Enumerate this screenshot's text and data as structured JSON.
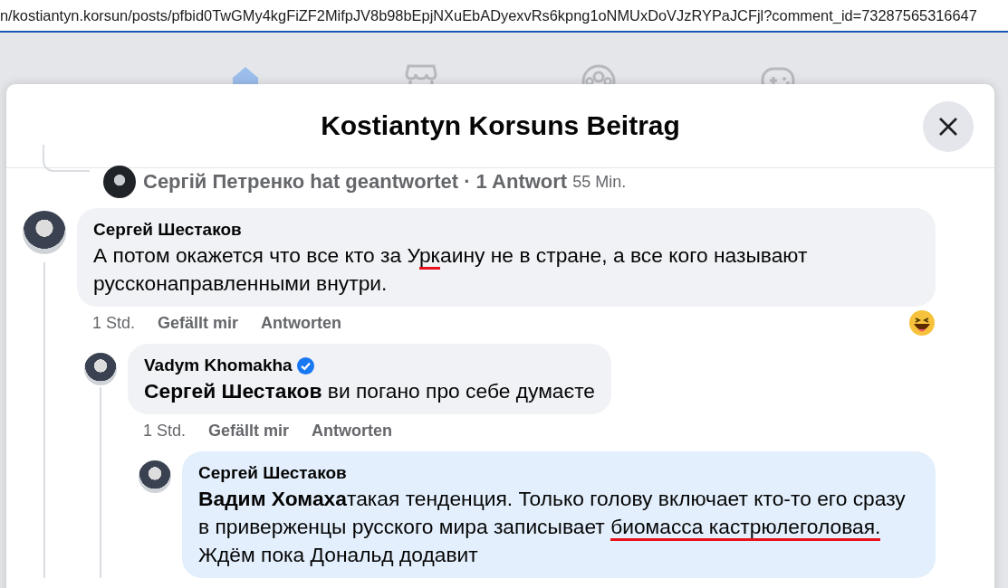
{
  "address_bar": {
    "url": "n/kostiantyn.korsun/posts/pfbid0TwGMy4kgFiZF2MifpJV8b98bEpjNXuEbADyexvRs6kpng1oNMUxDoVJzRYPaJCFjl?comment_id=73287565316647"
  },
  "nav_icons": [
    {
      "kind": "home",
      "selected": true
    },
    {
      "kind": "store",
      "selected": false
    },
    {
      "kind": "groups",
      "selected": false
    },
    {
      "kind": "gaming",
      "selected": false
    }
  ],
  "dialog": {
    "title": "Kostiantyn Korsuns Beitrag",
    "collapsed_reply": {
      "summary": "Сергій Петренко hat geantwortet · 1 Antwort",
      "time": "55 Min."
    },
    "comments": [
      {
        "author": "Сергей Шестаков",
        "verified": false,
        "highlighted": false,
        "body": [
          {
            "text": "А потом окажется что все кто за У",
            "underlined": false
          },
          {
            "text": "рк",
            "underlined": true
          },
          {
            "text": "аину не в стране, а все кого называют руссконаправленными внутри.",
            "underlined": false
          }
        ],
        "time": "1 Std.",
        "like": "Gefällt mir",
        "reply": "Antworten",
        "laughing_reaction": true,
        "replies": [
          {
            "author": "Vadym Khomakha",
            "verified": true,
            "highlighted": false,
            "body": [
              {
                "text": "**Сергей Шестаков** ви погано про себе думаєте",
                "underlined": false
              }
            ],
            "time": "1 Std.",
            "like": "Gefällt mir",
            "reply": "Antworten",
            "laughing_reaction": false,
            "replies": [
              {
                "author": "Сергей Шестаков",
                "verified": false,
                "highlighted": true,
                "body": [
                  {
                    "text": "**Вадим Хомаха**такая тенденция. Только голову включает кто-то его сразу в приверженцы русского мира записывает ",
                    "underlined": false
                  },
                  {
                    "text": "биомасса кастрюлеголовая.",
                    "underlined": true
                  },
                  {
                    "text": "\nЖдём пока Дональд додавит",
                    "underlined": false
                  }
                ]
              }
            ]
          }
        ]
      }
    ]
  }
}
